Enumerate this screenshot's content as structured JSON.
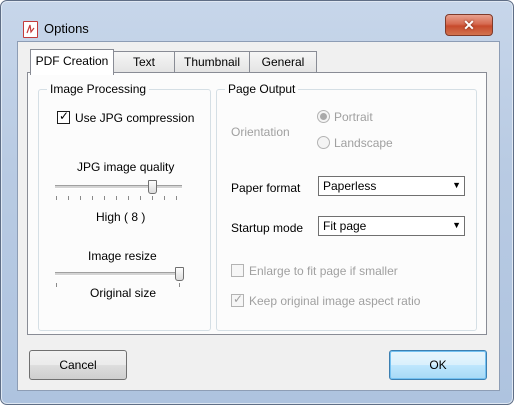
{
  "window": {
    "title": "Options",
    "close_glyph": "✕"
  },
  "tabs": [
    {
      "label": "PDF Creation",
      "active": true
    },
    {
      "label": "Text",
      "active": false
    },
    {
      "label": "Thumbnail",
      "active": false
    },
    {
      "label": "General",
      "active": false
    }
  ],
  "image_processing": {
    "title": "Image Processing",
    "use_jpg_compression": {
      "label": "Use JPG compression",
      "checked": true
    },
    "jpg_quality": {
      "label": "JPG image quality",
      "value_text": "High ( 8 )",
      "position_fraction": 0.8
    },
    "image_resize": {
      "label": "Image resize",
      "value_text": "Original size",
      "position_fraction": 1.0
    }
  },
  "page_output": {
    "title": "Page Output",
    "orientation": {
      "label": "Orientation",
      "options": [
        "Portrait",
        "Landscape"
      ],
      "selected": "Portrait",
      "disabled": true
    },
    "paper_format": {
      "label": "Paper format",
      "value": "Paperless"
    },
    "startup_mode": {
      "label": "Startup mode",
      "value": "Fit page"
    },
    "enlarge": {
      "label": "Enlarge to fit page if smaller",
      "checked": false,
      "disabled": true
    },
    "keep_aspect": {
      "label": "Keep original image aspect ratio",
      "checked": true,
      "disabled": true
    }
  },
  "buttons": {
    "cancel": "Cancel",
    "ok": "OK"
  },
  "icons": {
    "app": "pdf-icon",
    "close": "close-icon",
    "dropdown": "chevron-down-icon",
    "check": "checkmark-icon"
  }
}
